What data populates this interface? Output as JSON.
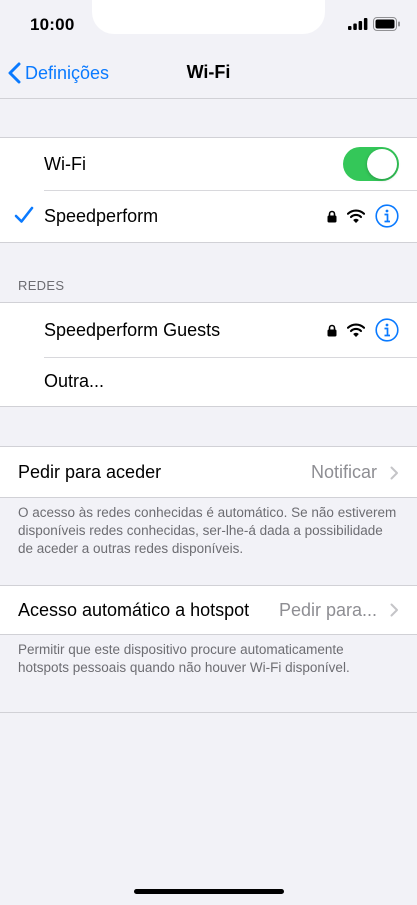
{
  "status": {
    "time": "10:00"
  },
  "nav": {
    "back_label": "Definições",
    "title": "Wi-Fi"
  },
  "wifi": {
    "toggle_label": "Wi-Fi",
    "toggle_on": true,
    "connected_network": "Speedperform"
  },
  "networks": {
    "header": "REDES",
    "items": [
      {
        "name": "Speedperform Guests"
      },
      {
        "name": "Outra..."
      }
    ]
  },
  "ask_join": {
    "label": "Pedir para aceder",
    "value": "Notificar",
    "footer": "O acesso às redes conhecidas é automático. Se não estiverem disponíveis redes conhecidas, ser-lhe-á dada a possibilidade de aceder a outras redes disponíveis."
  },
  "hotspot": {
    "label": "Acesso automático a hotspot",
    "value": "Pedir para...",
    "footer": "Permitir que este dispositivo procure automaticamente hotspots pessoais quando não houver Wi-Fi disponível."
  },
  "colors": {
    "accent": "#0a7aff",
    "toggle_on": "#34c759",
    "background": "#f2f2f7"
  }
}
